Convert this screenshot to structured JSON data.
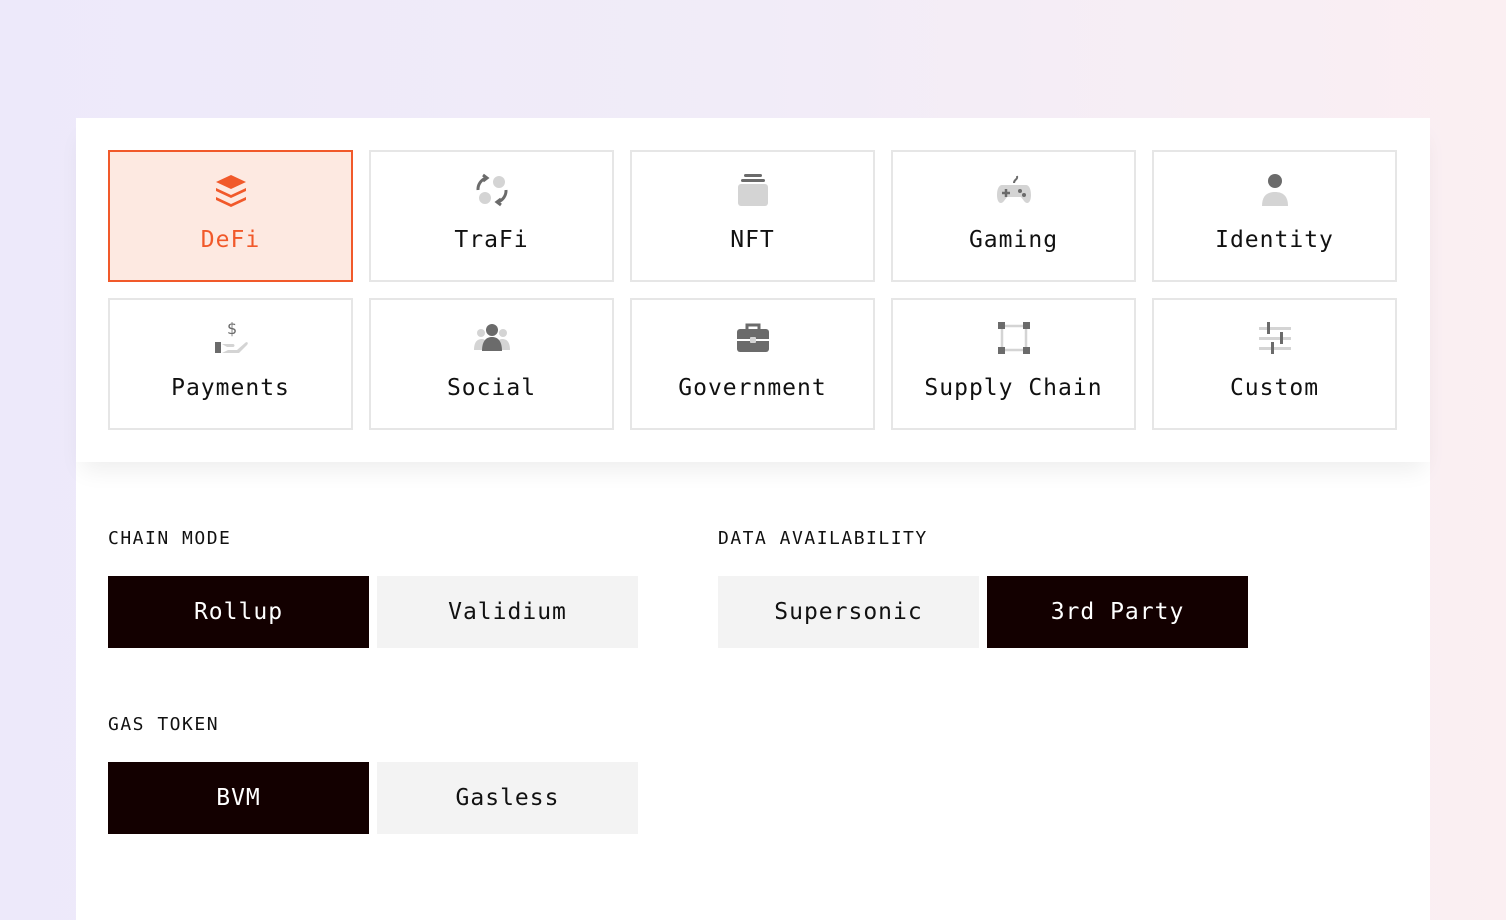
{
  "categories": [
    {
      "label": "DeFi",
      "icon": "layers-icon",
      "selected": true
    },
    {
      "label": "TraFi",
      "icon": "exchange-icon",
      "selected": false
    },
    {
      "label": "NFT",
      "icon": "collection-icon",
      "selected": false
    },
    {
      "label": "Gaming",
      "icon": "gamepad-icon",
      "selected": false
    },
    {
      "label": "Identity",
      "icon": "user-icon",
      "selected": false
    },
    {
      "label": "Payments",
      "icon": "hand-dollar-icon",
      "selected": false
    },
    {
      "label": "Social",
      "icon": "group-icon",
      "selected": false
    },
    {
      "label": "Government",
      "icon": "briefcase-icon",
      "selected": false
    },
    {
      "label": "Supply Chain",
      "icon": "network-square-icon",
      "selected": false
    },
    {
      "label": "Custom",
      "icon": "sliders-icon",
      "selected": false
    }
  ],
  "chain_mode": {
    "title": "CHAIN MODE",
    "options": [
      {
        "label": "Rollup",
        "active": true
      },
      {
        "label": "Validium",
        "active": false
      }
    ]
  },
  "data_availability": {
    "title": "DATA AVAILABILITY",
    "options": [
      {
        "label": "Supersonic",
        "active": false
      },
      {
        "label": "3rd Party",
        "active": true
      }
    ]
  },
  "gas_token": {
    "title": "GAS TOKEN",
    "options": [
      {
        "label": "BVM",
        "active": true
      },
      {
        "label": "Gasless",
        "active": false
      }
    ]
  },
  "colors": {
    "accent": "#f1592a",
    "selected_bg": "#fde9e1",
    "active_toggle": "#130000",
    "inactive_toggle": "#f3f3f3",
    "icon_dark": "#6b6b6b",
    "icon_light": "#d4d4d4"
  }
}
